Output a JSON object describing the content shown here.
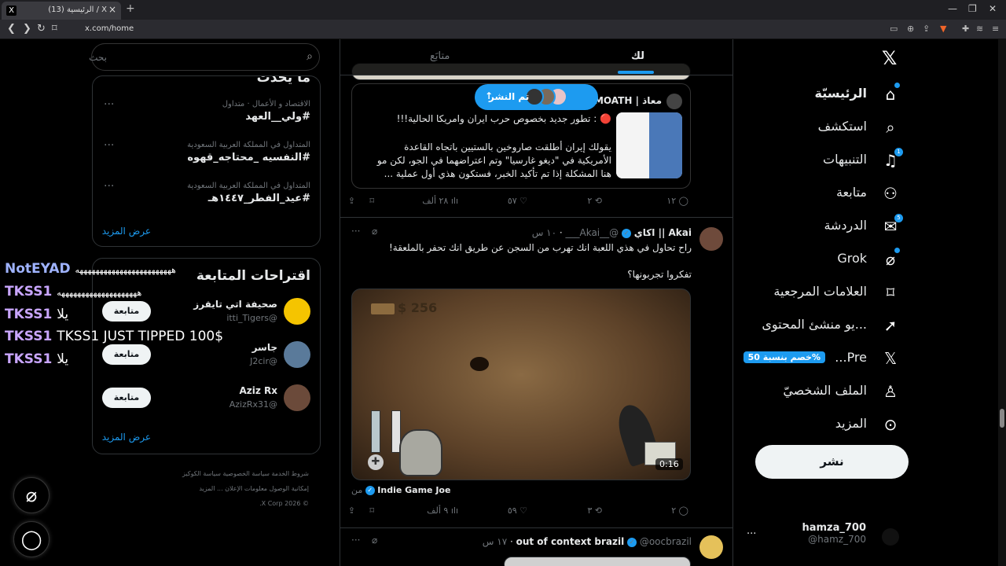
{
  "browser": {
    "tab_title": "(13) الرئيسية / X",
    "favicon": "X",
    "close": "×",
    "new_tab": "+",
    "url": "x.com/home"
  },
  "search": {
    "placeholder": "بحث"
  },
  "trends": {
    "heading": "ما يحدث",
    "items": [
      {
        "meta": "الاقتصاد و الأعمال · متداول",
        "tag": "#ولي__العهد"
      },
      {
        "meta": "المتداول في المملكة العربية السعودية",
        "tag": "#النفسيه _محتاجه_قهوه"
      },
      {
        "meta": "المتداول في المملكة العربية السعودية",
        "tag": "#عيد_الفطر_١٤٤٧هـ"
      }
    ],
    "show_more": "عرض المزيد"
  },
  "follow": {
    "heading": "اقتراحات المتابعة",
    "items": [
      {
        "name": "صحيفة اتي تايقرز",
        "handle": "@itti_Tigers",
        "button": "متابعة"
      },
      {
        "name": "جاسر",
        "handle": "@J2cir",
        "button": "متابعة"
      },
      {
        "name": "Aziz Rx",
        "handle": "@AzizRx31",
        "button": "متابعة"
      }
    ],
    "show_more": "عرض المزيد"
  },
  "footer": {
    "line1": "شروط الخدمة    سياسة الخصوصية    سياسة الكوكيز",
    "line2": "إمكانية الوصول    معلومات الإعلان    ... المزيد",
    "line3": "© 2026 X Corp."
  },
  "stream_chat": [
    {
      "user": "NotEYAD",
      "msg": "ههههههههههههههههههههههههه"
    },
    {
      "user": "TKSS1",
      "msg": "ههههههههههههههههههههه"
    },
    {
      "user": "TKSS1",
      "msg": "يلا"
    },
    {
      "user": "TKSS1",
      "msg": "TKSS1 JUST TIPPED 100$"
    },
    {
      "user": "TKSS1",
      "msg": "يلا"
    }
  ],
  "timeline": {
    "tab_for_you": "لك",
    "tab_following": "متابَع",
    "new_posts": "تم النشر",
    "tweet1": {
      "author": "معاذ | MOATH",
      "text1": "🔴 : تطور جديد بخصوص حرب ايران وامريكا الحالية!!!",
      "text2": "يقولك إيران أطلقت صاروخين بالستيين باتجاه القاعدة",
      "text3": "الأمريكية في \"ديغو غارسيا\" وتم اعتراضهما في الجو، لكن مو",
      "text4": "هنا المشكلة إذا تم تأكيد الخبر، فستكون هذي أول عملية ...",
      "replies": "١٢",
      "retweets": "٢",
      "likes": "٥٧",
      "views": "٢٨ ألف"
    },
    "tweet2": {
      "author": "Akai || اكاي",
      "handle": "@__Akai___",
      "time": "١٠ س",
      "text1": "راح تحاول في هذي اللعبة انك تهرب من السجن عن طريق انك تحفر بالملعقة!",
      "text2": "تفكروا تجربونها؟",
      "game_money": "256 $",
      "duration": "0:16",
      "from_label": "من",
      "from_account": "Indie Game Joe",
      "replies": "٢",
      "retweets": "٣",
      "likes": "٥٩",
      "views": "٩ ألف"
    },
    "tweet3": {
      "author": "out of context brazil",
      "handle": "@oocbrazil",
      "time": "١٧ س"
    }
  },
  "sidenav": {
    "items": [
      {
        "label": "الرئيسيّة",
        "icon": "home-icon"
      },
      {
        "label": "استكشف",
        "icon": "search-icon"
      },
      {
        "label": "التنبيهات",
        "icon": "bell-icon",
        "badge": "1"
      },
      {
        "label": "متابعة",
        "icon": "follow-icon"
      },
      {
        "label": "الدردشة",
        "icon": "mail-icon",
        "badge": "5"
      },
      {
        "label": "Grok",
        "icon": "grok-icon"
      },
      {
        "label": "العلامات المرجعية",
        "icon": "bookmark-icon"
      },
      {
        "label": "...يو منشئ المحتوى",
        "icon": "rocket-icon"
      },
      {
        "label": "Pre...",
        "icon": "x-premium-icon"
      },
      {
        "label": "الملف الشخصيّ",
        "icon": "profile-icon"
      },
      {
        "label": "المزيد",
        "icon": "more-icon"
      }
    ],
    "premium_promo": "%خصم بنسبة 50",
    "post_button": "نشر",
    "account_name": "hamza_700",
    "account_handle": "@hamz_700"
  },
  "colors": {
    "accent": "#1d9bf0",
    "bg": "#000000",
    "text": "#e7e9ea",
    "muted": "#71767b"
  }
}
